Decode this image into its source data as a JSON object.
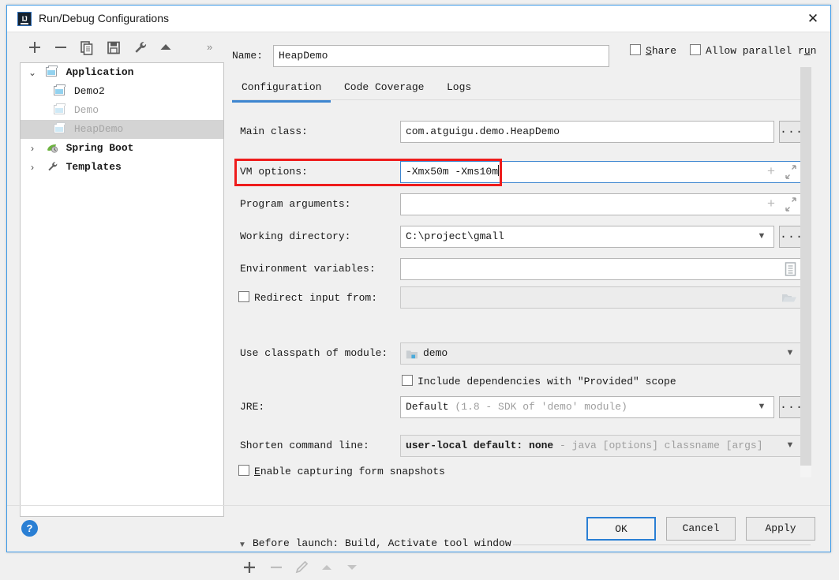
{
  "window": {
    "title": "Run/Debug Configurations",
    "logo_text": "IJ",
    "close_icon": "close-icon"
  },
  "toolbar": {
    "items": [
      {
        "name": "add-configuration-button",
        "icon": "plus-icon"
      },
      {
        "name": "remove-configuration-button",
        "icon": "minus-icon"
      },
      {
        "name": "copy-configuration-button",
        "icon": "copy-icon"
      },
      {
        "name": "save-configuration-button",
        "icon": "save-icon"
      },
      {
        "name": "edit-templates-button",
        "icon": "wrench-icon"
      },
      {
        "name": "move-up-button",
        "icon": "arrow-up-icon"
      }
    ],
    "overflow_label": "»"
  },
  "tree": {
    "nodes": [
      {
        "label": "Application",
        "level": 0,
        "expander": "⌄",
        "bold": true,
        "dim": false,
        "selected": false,
        "icon": "module-icon"
      },
      {
        "label": "Demo2",
        "level": 1,
        "expander": "",
        "bold": false,
        "dim": false,
        "selected": false,
        "icon": "run-config-icon"
      },
      {
        "label": "Demo",
        "level": 1,
        "expander": "",
        "bold": false,
        "dim": true,
        "selected": false,
        "icon": "run-config-icon"
      },
      {
        "label": "HeapDemo",
        "level": 1,
        "expander": "",
        "bold": false,
        "dim": true,
        "selected": true,
        "icon": "run-config-icon"
      },
      {
        "label": "Spring Boot",
        "level": 0,
        "expander": "›",
        "bold": true,
        "dim": false,
        "selected": false,
        "icon": "spring-leaf-icon"
      },
      {
        "label": "Templates",
        "level": 0,
        "expander": "›",
        "bold": true,
        "dim": false,
        "selected": false,
        "icon": "wrench-icon"
      }
    ]
  },
  "header": {
    "name_label": "Name:",
    "name_value": "HeapDemo",
    "share_label": "Share",
    "share_mnemonic": "S",
    "share_rest": "hare",
    "share_checked": false,
    "parallel_label": "Allow parallel run",
    "parallel_pre": "Allow parallel r",
    "parallel_mnemonic": "u",
    "parallel_post": "n",
    "parallel_checked": false
  },
  "tabs": [
    {
      "label": "Configuration",
      "active": true
    },
    {
      "label": "Code Coverage",
      "active": false
    },
    {
      "label": "Logs",
      "active": false
    }
  ],
  "form": {
    "main_class": {
      "label": "Main class:",
      "value": "com.atguigu.demo.HeapDemo",
      "browse": "..."
    },
    "vm_options": {
      "label": "VM options:",
      "value": "-Xmx50m -Xms10m",
      "focused": true,
      "highlighted": true
    },
    "program_arguments": {
      "label": "Program arguments:",
      "value": ""
    },
    "working_directory": {
      "label": "Working directory:",
      "value": "C:\\project\\gmall",
      "browse": "..."
    },
    "environment_variables": {
      "label": "Environment variables:",
      "value": ""
    },
    "redirect_input": {
      "label": "Redirect input from:",
      "checked": false,
      "value": "",
      "disabled": true
    },
    "classpath_module": {
      "label": "Use classpath of module:",
      "value": "demo"
    },
    "include_dependencies": {
      "label": "Include dependencies with \"Provided\" scope",
      "checked": false
    },
    "jre": {
      "label": "JRE:",
      "value": "Default",
      "hint": "(1.8 - SDK of 'demo' module)",
      "browse": "..."
    },
    "shorten_command_line": {
      "label": "Shorten command line:",
      "value": "user-local default: none",
      "hint": "- java [options] classname [args]"
    },
    "enable_snapshots": {
      "label": "Enable capturing form snapshots",
      "mnemonic": "E",
      "rest": "nable capturing form snapshots",
      "checked": false
    }
  },
  "before_launch": {
    "expander": "▼",
    "label": "Before launch: Build, Activate tool window",
    "buttons": [
      {
        "name": "before-launch-add-button",
        "icon": "plus-icon",
        "enabled": true
      },
      {
        "name": "before-launch-remove-button",
        "icon": "minus-icon",
        "enabled": false
      },
      {
        "name": "before-launch-edit-button",
        "icon": "pencil-icon",
        "enabled": false
      },
      {
        "name": "before-launch-move-up-button",
        "icon": "arrow-up-icon",
        "enabled": false
      },
      {
        "name": "before-launch-move-down-button",
        "icon": "arrow-down-icon",
        "enabled": false
      }
    ]
  },
  "footer": {
    "help_label": "?",
    "ok_label": "OK",
    "cancel_label": "Cancel",
    "apply_label": "Apply"
  },
  "colors": {
    "accent": "#3d86d0",
    "highlight_box": "#ee1c1c",
    "selection": "#d4d4d4"
  }
}
